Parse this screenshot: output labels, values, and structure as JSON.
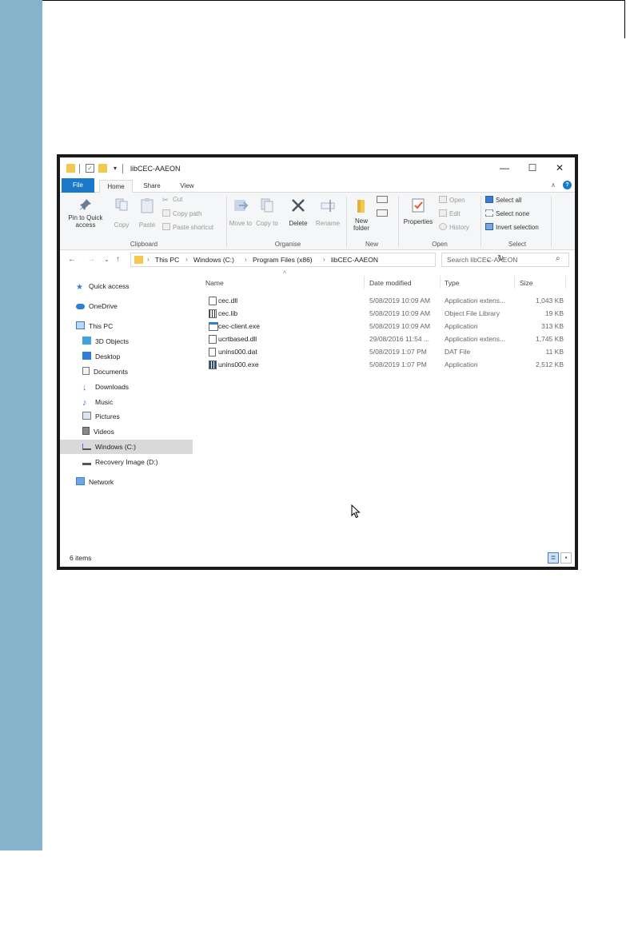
{
  "window": {
    "title": "libCEC-AAEON",
    "quick_access_dropdown": "▾",
    "controls": {
      "minimize": "—",
      "maximize": "☐",
      "close": "✕"
    }
  },
  "ribbon_tabs": [
    "File",
    "Home",
    "Share",
    "View"
  ],
  "ribbon": {
    "collapse_icon": "∧",
    "help_icon": "?",
    "clipboard": {
      "label": "Clipboard",
      "pin_to_quick_access": "Pin to Quick access",
      "copy": "Copy",
      "paste": "Paste",
      "cut": "Cut",
      "copy_path": "Copy path",
      "paste_shortcut": "Paste shortcut"
    },
    "organise": {
      "label": "Organise",
      "move_to": "Move to",
      "copy_to": "Copy to",
      "delete": "Delete",
      "rename": "Rename"
    },
    "new": {
      "label": "New",
      "new_folder": "New folder"
    },
    "open": {
      "label": "Open",
      "properties": "Properties",
      "open": "Open",
      "edit": "Edit",
      "history": "History"
    },
    "select": {
      "label": "Select",
      "select_all": "Select all",
      "select_none": "Select none",
      "invert_selection": "Invert selection"
    }
  },
  "address_bar": {
    "crumbs": [
      "This PC",
      "Windows (C:)",
      "Program Files (x86)",
      "libCEC-AAEON"
    ],
    "separator": "›",
    "search_placeholder": "Search libCEC-AAEON"
  },
  "nav_pane": {
    "items": [
      {
        "label": "Quick access",
        "icon": "star-icon"
      },
      {
        "label": "OneDrive",
        "icon": "cloud-icon"
      },
      {
        "label": "This PC",
        "icon": "computer-icon"
      },
      {
        "label": "3D Objects",
        "icon": "cube-icon"
      },
      {
        "label": "Desktop",
        "icon": "desktop-icon"
      },
      {
        "label": "Documents",
        "icon": "document-icon"
      },
      {
        "label": "Downloads",
        "icon": "download-icon"
      },
      {
        "label": "Music",
        "icon": "music-icon"
      },
      {
        "label": "Pictures",
        "icon": "picture-icon"
      },
      {
        "label": "Videos",
        "icon": "video-icon"
      },
      {
        "label": "Windows (C:)",
        "icon": "drive-icon",
        "selected": true
      },
      {
        "label": "Recovery Image (D:)",
        "icon": "drive-icon"
      },
      {
        "label": "Network",
        "icon": "network-icon"
      }
    ]
  },
  "columns": {
    "name": "Name",
    "date_modified": "Date modified",
    "type": "Type",
    "size": "Size"
  },
  "files": [
    {
      "name": "cec.dll",
      "date": "5/08/2019 10:09 AM",
      "type": "Application extens...",
      "size": "1,043 KB"
    },
    {
      "name": "cec.lib",
      "date": "5/08/2019 10:09 AM",
      "type": "Object File Library",
      "size": "19 KB"
    },
    {
      "name": "cec-client.exe",
      "date": "5/08/2019 10:09 AM",
      "type": "Application",
      "size": "313 KB"
    },
    {
      "name": "ucrtbased.dll",
      "date": "29/08/2016 11:54 ...",
      "type": "Application extens...",
      "size": "1,745 KB"
    },
    {
      "name": "unins000.dat",
      "date": "5/08/2019 1:07 PM",
      "type": "DAT File",
      "size": "11 KB"
    },
    {
      "name": "unins000.exe",
      "date": "5/08/2019 1:07 PM",
      "type": "Application",
      "size": "2,512 KB"
    }
  ],
  "status": {
    "count": "6 items"
  },
  "colors": {
    "side_bar": "#84b3cb",
    "file_tab": "#1979ca",
    "selected_nav": "#d9d9d9"
  }
}
